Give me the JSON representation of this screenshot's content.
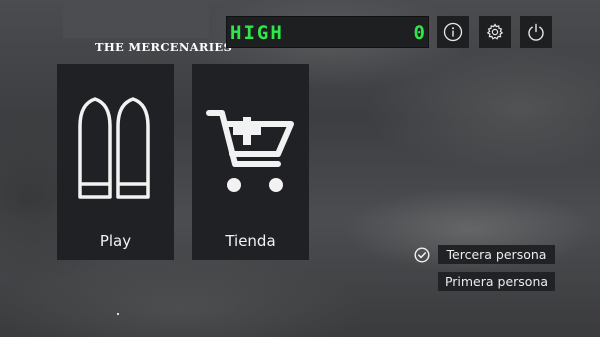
{
  "header": {
    "game_title": "THE MERCENARIES",
    "score_label": "HIGH",
    "score_value": "0"
  },
  "toolbar": {
    "icons": [
      "info-icon",
      "gear-icon",
      "power-icon"
    ]
  },
  "menu": {
    "play_label": "Play",
    "shop_label": "Tienda"
  },
  "camera_options": {
    "items": [
      "Tercera persona",
      "Primera persona"
    ],
    "selected": "Tercera persona"
  },
  "colors": {
    "score_green": "#2ee84a",
    "panel": "#1f2124",
    "text": "#f2f2f2"
  }
}
